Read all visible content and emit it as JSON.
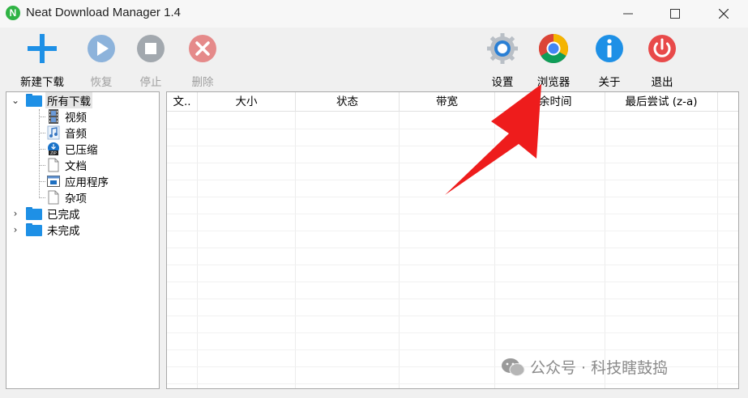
{
  "window": {
    "title": "Neat Download Manager 1.4",
    "minimize": "—",
    "maximize": "☐",
    "close": "✕"
  },
  "toolbar": {
    "new_download": "新建下载",
    "resume": "恢复",
    "stop": "停止",
    "delete": "删除",
    "settings": "设置",
    "browser": "浏览器",
    "about": "关于",
    "exit": "退出"
  },
  "tree": {
    "all_downloads": "所有下载",
    "video": "视频",
    "audio": "音频",
    "compressed": "已压缩",
    "documents": "文档",
    "applications": "应用程序",
    "misc": "杂项",
    "completed": "已完成",
    "unfinished": "未完成"
  },
  "columns": [
    "文..",
    "大小",
    "状态",
    "带宽",
    "剩余时间",
    "最后尝试 (z-a)"
  ],
  "watermark": "公众号 · 科技瞎鼓捣",
  "colors": {
    "accent_blue": "#1e90e6",
    "arrow_red": "#ee1c1c",
    "exit_red": "#e84a4a"
  }
}
